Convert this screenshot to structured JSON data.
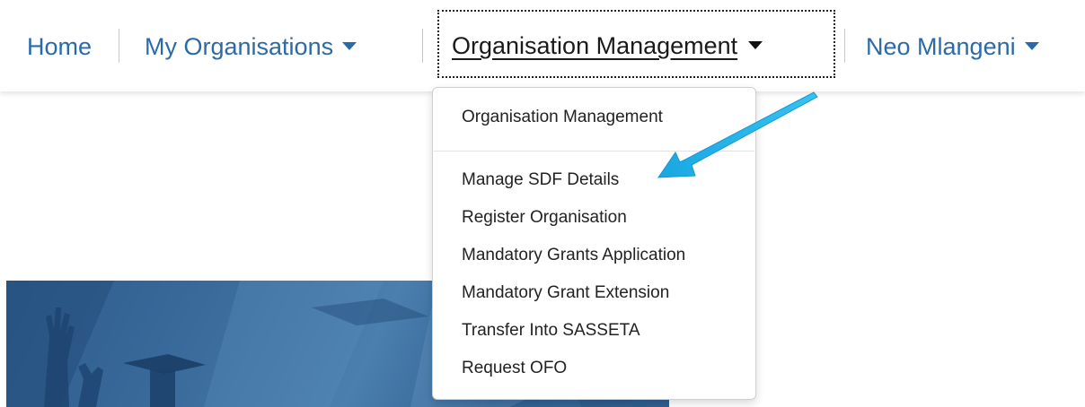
{
  "nav": {
    "home_label": "Home",
    "my_organisations_label": "My Organisations",
    "organisation_management_label": "Organisation Management",
    "user_label": "Neo Mlangeni"
  },
  "dropdown": {
    "header_item": "Organisation Management",
    "items": [
      "Manage SDF Details",
      "Register Organisation",
      "Mandatory Grants Application",
      "Mandatory Grant Extension",
      "Transfer Into SASSETA",
      "Request OFO"
    ]
  },
  "colors": {
    "nav_link": "#2a6aa8",
    "annotation_arrow": "#1fb0e8",
    "hero_background": "#3a6b9b"
  },
  "icons": {
    "dropdown_caret": "caret-down-icon",
    "annotation": "arrow-icon"
  }
}
